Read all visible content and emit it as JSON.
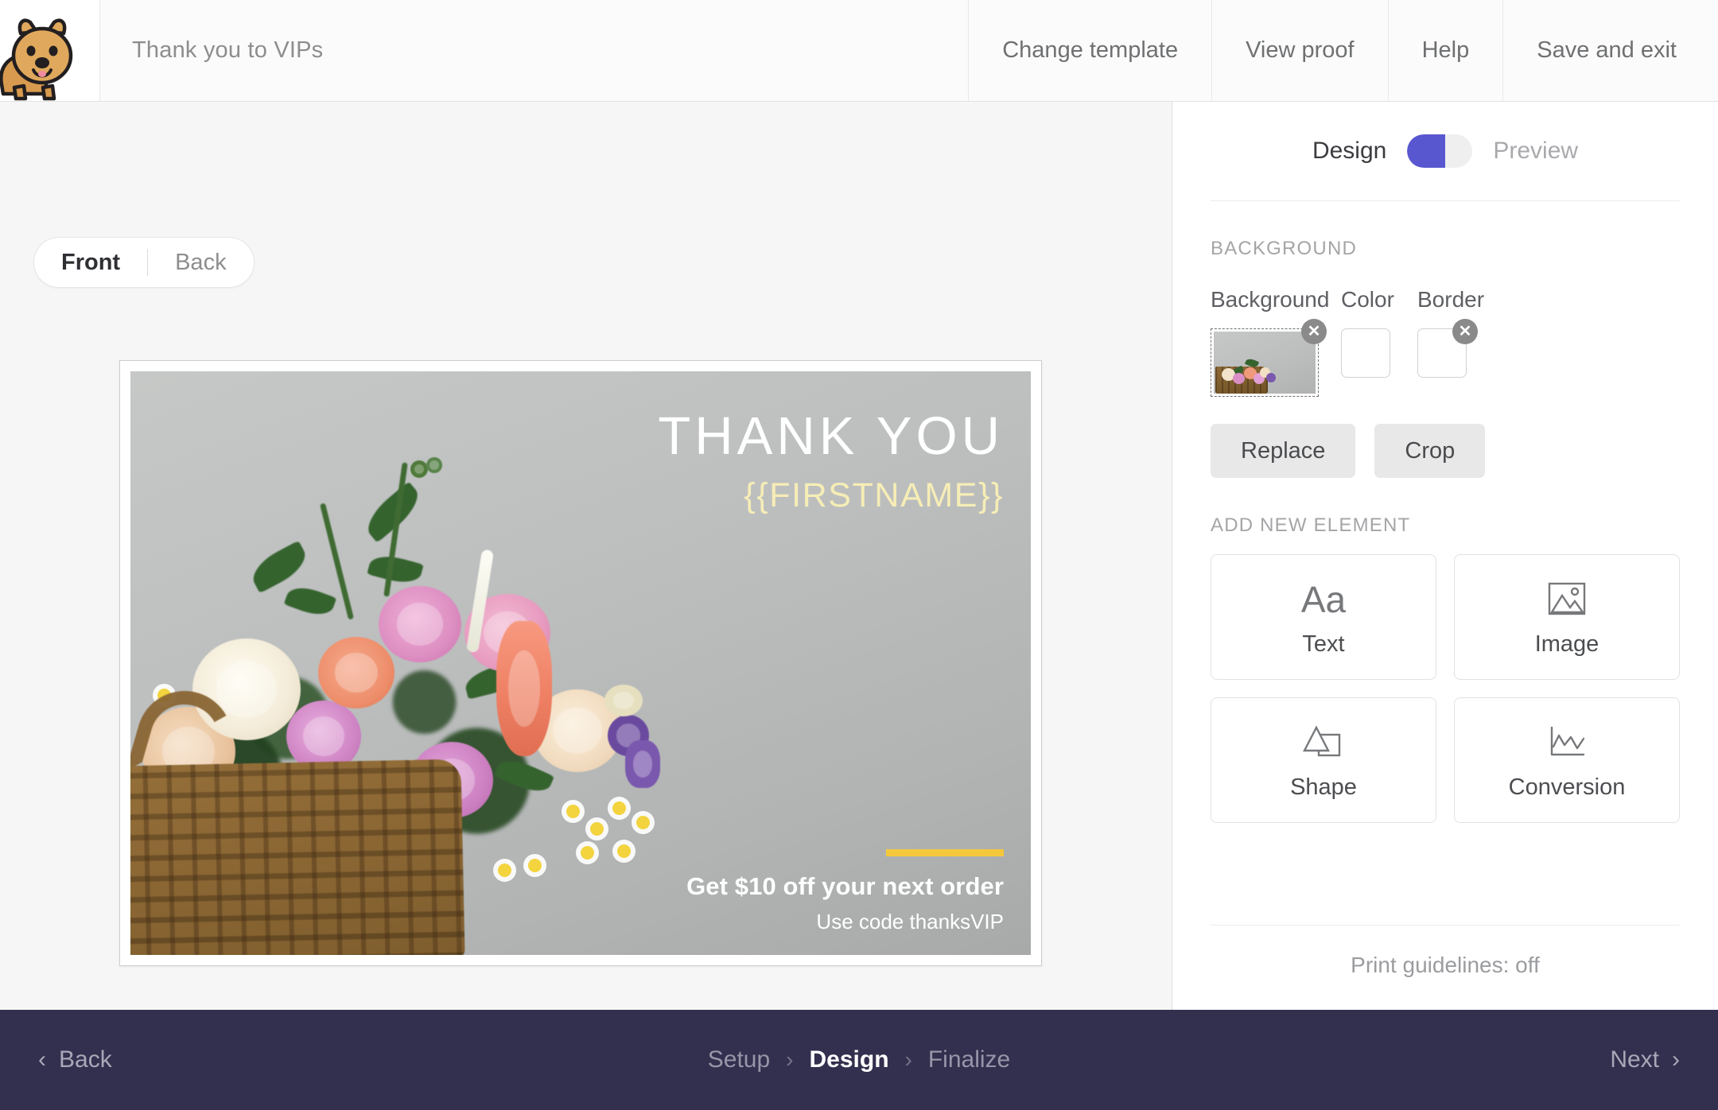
{
  "topbar": {
    "logo_icon": "quokka-mascot-logo",
    "doc_title": "Thank you to VIPs",
    "nav": [
      {
        "label": "Change template"
      },
      {
        "label": "View proof"
      },
      {
        "label": "Help"
      },
      {
        "label": "Save and exit"
      }
    ]
  },
  "canvas": {
    "side_toggle": {
      "front": "Front",
      "back": "Back",
      "active": "Front"
    },
    "card": {
      "heading": "THANK YOU",
      "merge_tag": "{{FIRSTNAME}}",
      "offer": "Get $10 off your next order",
      "promo": "Use code thanksVIP",
      "accent_color": "#f5c83c",
      "merge_tag_color": "#f6edb6",
      "heading_color": "#ffffff"
    }
  },
  "panel": {
    "mode_toggle": {
      "left": "Design",
      "right": "Preview",
      "active": "Design",
      "accent": "#5957cf"
    },
    "background_section": {
      "title": "BACKGROUND",
      "labels": {
        "background": "Background",
        "color": "Color",
        "border": "Border"
      },
      "background_remove": "✕",
      "border_remove": "✕",
      "color_value": "#ffffff",
      "border_value": "#ffffff",
      "buttons": {
        "replace": "Replace",
        "crop": "Crop"
      }
    },
    "add_element_section": {
      "title": "ADD NEW ELEMENT",
      "items": [
        {
          "label": "Text",
          "icon": "text-aa-icon"
        },
        {
          "label": "Image",
          "icon": "image-picture-icon"
        },
        {
          "label": "Shape",
          "icon": "shape-triangle-square-icon"
        },
        {
          "label": "Conversion",
          "icon": "conversion-chart-icon"
        }
      ]
    },
    "print_guidelines": "Print guidelines: off"
  },
  "bottombar": {
    "back": "Back",
    "next": "Next",
    "back_chevron": "‹",
    "next_chevron": "›",
    "breadcrumbs": [
      {
        "label": "Setup",
        "current": false
      },
      {
        "label": "Design",
        "current": true
      },
      {
        "label": "Finalize",
        "current": false
      }
    ],
    "separator": "›"
  }
}
